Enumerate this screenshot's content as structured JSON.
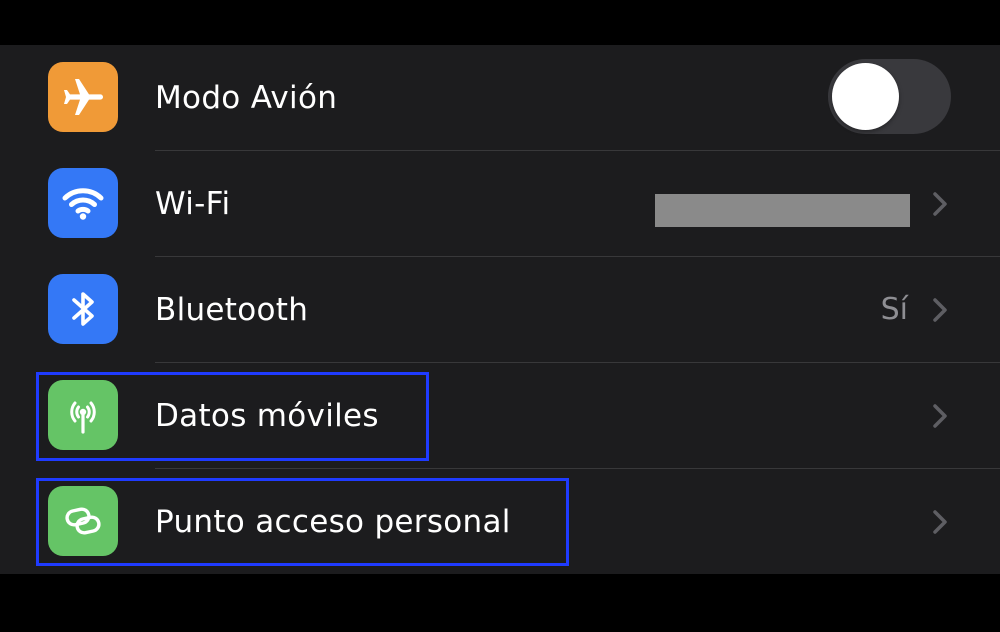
{
  "colors": {
    "background": "#000000",
    "panel": "#1c1c1e",
    "separator": "#38383a",
    "text": "#ffffff",
    "secondary_text": "#8e8e93",
    "highlight_border": "#1f3bff"
  },
  "settings": {
    "rows": [
      {
        "label": "Modo Avión",
        "icon": "airplane-icon",
        "icon_color": "#f09a37",
        "accessory": "toggle",
        "toggle_on": false
      },
      {
        "label": "Wi-Fi",
        "icon": "wifi-icon",
        "icon_color": "#3478f6",
        "accessory": "redacted-value-chevron"
      },
      {
        "label": "Bluetooth",
        "icon": "bluetooth-icon",
        "icon_color": "#3478f6",
        "value": "Sí",
        "accessory": "value-chevron"
      },
      {
        "label": "Datos móviles",
        "icon": "antenna-icon",
        "icon_color": "#65c466",
        "accessory": "chevron",
        "highlighted": true
      },
      {
        "label": "Punto acceso personal",
        "icon": "hotspot-link-icon",
        "icon_color": "#65c466",
        "accessory": "chevron",
        "highlighted": true
      }
    ]
  }
}
